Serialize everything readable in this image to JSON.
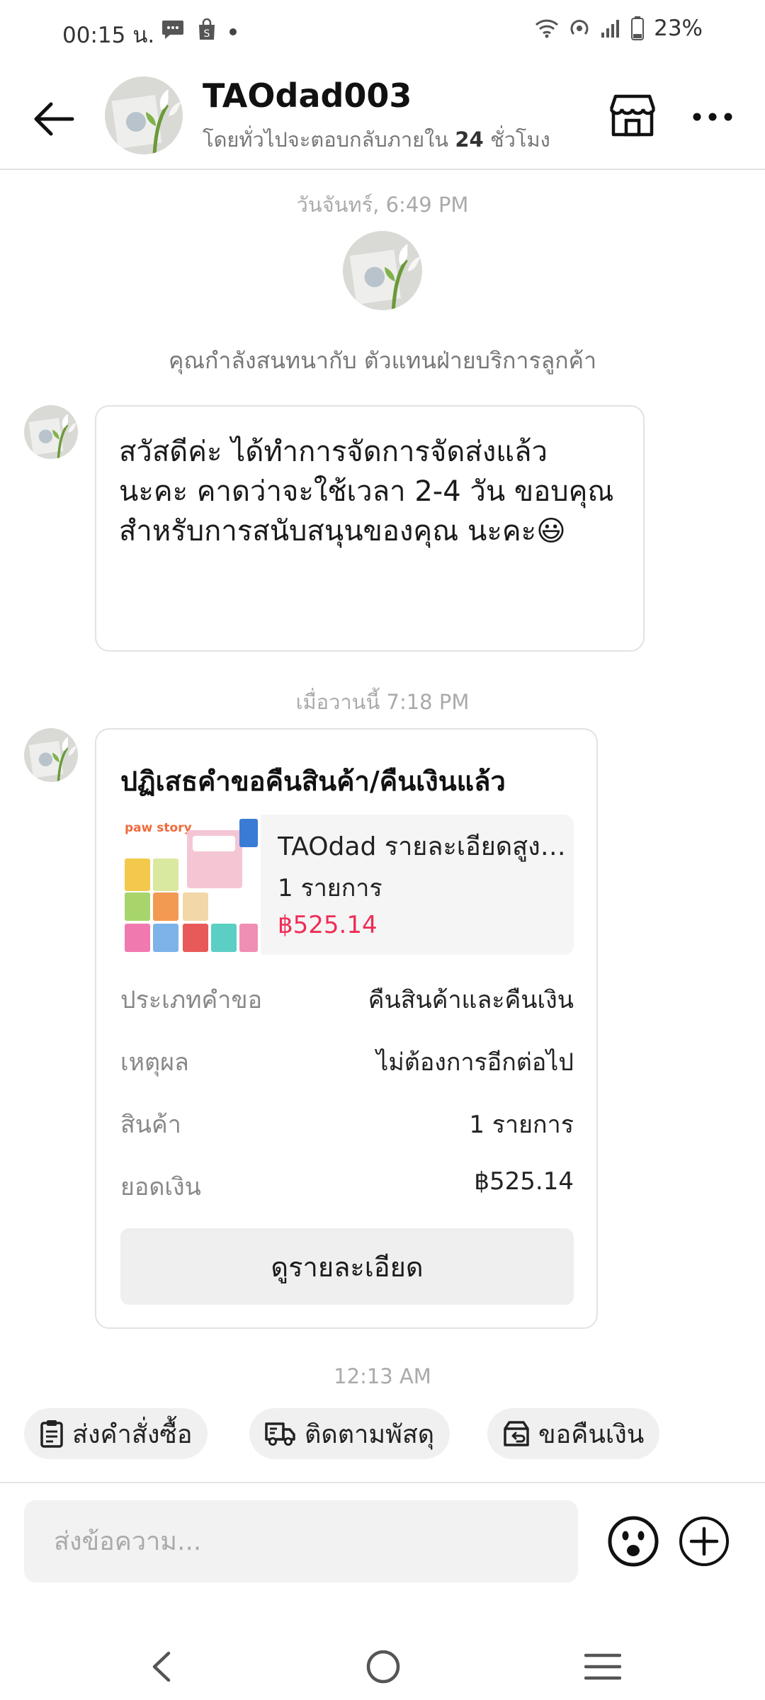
{
  "status_bar": {
    "time": "00:15 น.",
    "battery": "23%"
  },
  "header": {
    "back_icon": "arrow-left-icon",
    "shop_name": "TAOdad003",
    "reply_prefix": "โดยทั่วไปจะตอบกลับภายใน",
    "reply_hours": "24",
    "reply_suffix": "ชั่วโมง",
    "store_icon": "store-icon",
    "more_icon": "more-horizontal-icon"
  },
  "chat": {
    "timestamp_1": "วันจันทร์, 6:49 PM",
    "intro": "คุณกำลังสนทนากับ ตัวแทนฝ่ายบริการลูกค้า",
    "message_1": "สวัสดีค่ะ ได้ทำการจัดการจัดส่งแล้ว นะคะ คาดว่าจะใช้เวลา 2-4 วัน ขอบคุณสำหรับการสนับสนุนของคุณ นะคะ😃",
    "timestamp_2": "เมื่อวานนี้ 7:18 PM",
    "card": {
      "title": "ปฏิเสธคำขอคืนสินค้า/คืนเงินแล้ว",
      "product_name": "TAOdad รายละเอียดสูง ...",
      "product_qty": "1 รายการ",
      "product_price": "฿525.14",
      "product_image_text": "paw story",
      "rows": [
        {
          "label": "ประเภทคำขอ",
          "value": "คืนสินค้าและคืนเงิน"
        },
        {
          "label": "เหตุผล",
          "value": "ไม่ต้องการอีกต่อไป"
        },
        {
          "label": "สินค้า",
          "value": "1 รายการ"
        },
        {
          "label": "ยอดเงิน",
          "value": "฿525.14"
        }
      ],
      "details_button": "ดูรายละเอียด"
    },
    "timestamp_3": "12:13 AM"
  },
  "quick_actions": [
    {
      "label": "ส่งคำสั่งซื้อ",
      "icon": "clipboard-icon"
    },
    {
      "label": "ติดตามพัสดุ",
      "icon": "truck-icon"
    },
    {
      "label": "ขอคืนเงิน",
      "icon": "refund-box-icon"
    }
  ],
  "composer": {
    "placeholder": "ส่งข้อความ...",
    "emoji_icon": "emoji-icon",
    "plus_icon": "plus-icon"
  },
  "colors": {
    "price": "#ee2d55",
    "border": "#e2e2e2"
  }
}
